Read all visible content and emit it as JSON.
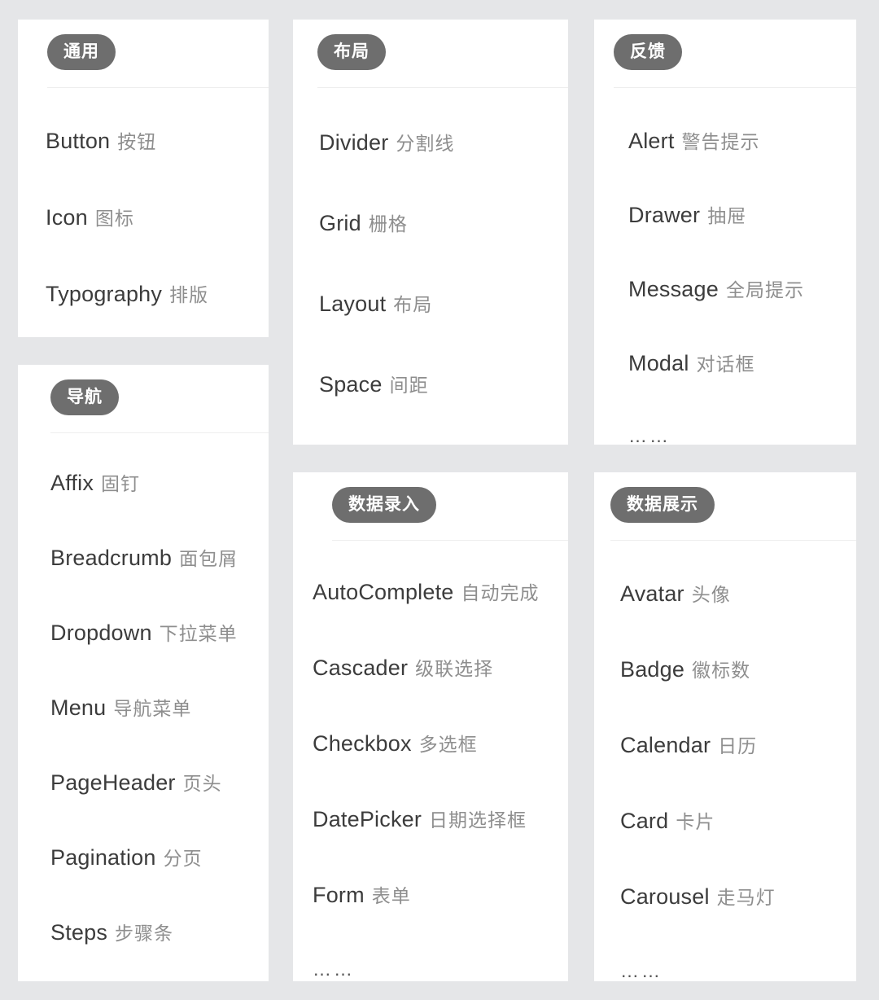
{
  "background_color": "#e5e6e8",
  "badge_color": "#6e6e6e",
  "badge_text_color": "#ffffff",
  "en_text_color": "#3c3c3c",
  "cn_text_color": "#8e8e8e",
  "card_background": "#ffffff",
  "divider_color": "#eeeeee",
  "ellipsis_glyph": "……",
  "cards": {
    "general": {
      "badge": "通用",
      "items": [
        {
          "en": "Button",
          "cn": "按钮"
        },
        {
          "en": "Icon",
          "cn": "图标"
        },
        {
          "en": "Typography",
          "cn": "排版"
        }
      ]
    },
    "navigation": {
      "badge": "导航",
      "items": [
        {
          "en": "Affix",
          "cn": "固钉"
        },
        {
          "en": "Breadcrumb",
          "cn": "面包屑"
        },
        {
          "en": "Dropdown",
          "cn": "下拉菜单"
        },
        {
          "en": "Menu",
          "cn": "导航菜单"
        },
        {
          "en": "PageHeader",
          "cn": "页头"
        },
        {
          "en": "Pagination",
          "cn": "分页"
        },
        {
          "en": "Steps",
          "cn": "步骤条"
        }
      ]
    },
    "layout": {
      "badge": "布局",
      "items": [
        {
          "en": "Divider",
          "cn": "分割线"
        },
        {
          "en": "Grid",
          "cn": "栅格"
        },
        {
          "en": "Layout",
          "cn": "布局"
        },
        {
          "en": "Space",
          "cn": "间距"
        }
      ]
    },
    "data_entry": {
      "badge": "数据录入",
      "items": [
        {
          "en": "AutoComplete",
          "cn": "自动完成"
        },
        {
          "en": "Cascader",
          "cn": "级联选择"
        },
        {
          "en": "Checkbox",
          "cn": "多选框"
        },
        {
          "en": "DatePicker",
          "cn": "日期选择框"
        },
        {
          "en": "Form",
          "cn": "表单"
        }
      ],
      "more": "……"
    },
    "feedback": {
      "badge": "反馈",
      "items": [
        {
          "en": "Alert",
          "cn": "警告提示"
        },
        {
          "en": "Drawer",
          "cn": "抽屉"
        },
        {
          "en": "Message",
          "cn": "全局提示"
        },
        {
          "en": "Modal",
          "cn": "对话框"
        }
      ],
      "more": "……"
    },
    "data_display": {
      "badge": "数据展示",
      "items": [
        {
          "en": "Avatar",
          "cn": "头像"
        },
        {
          "en": "Badge",
          "cn": "徽标数"
        },
        {
          "en": "Calendar",
          "cn": "日历"
        },
        {
          "en": "Card",
          "cn": "卡片"
        },
        {
          "en": "Carousel",
          "cn": "走马灯"
        }
      ],
      "more": "……"
    }
  }
}
